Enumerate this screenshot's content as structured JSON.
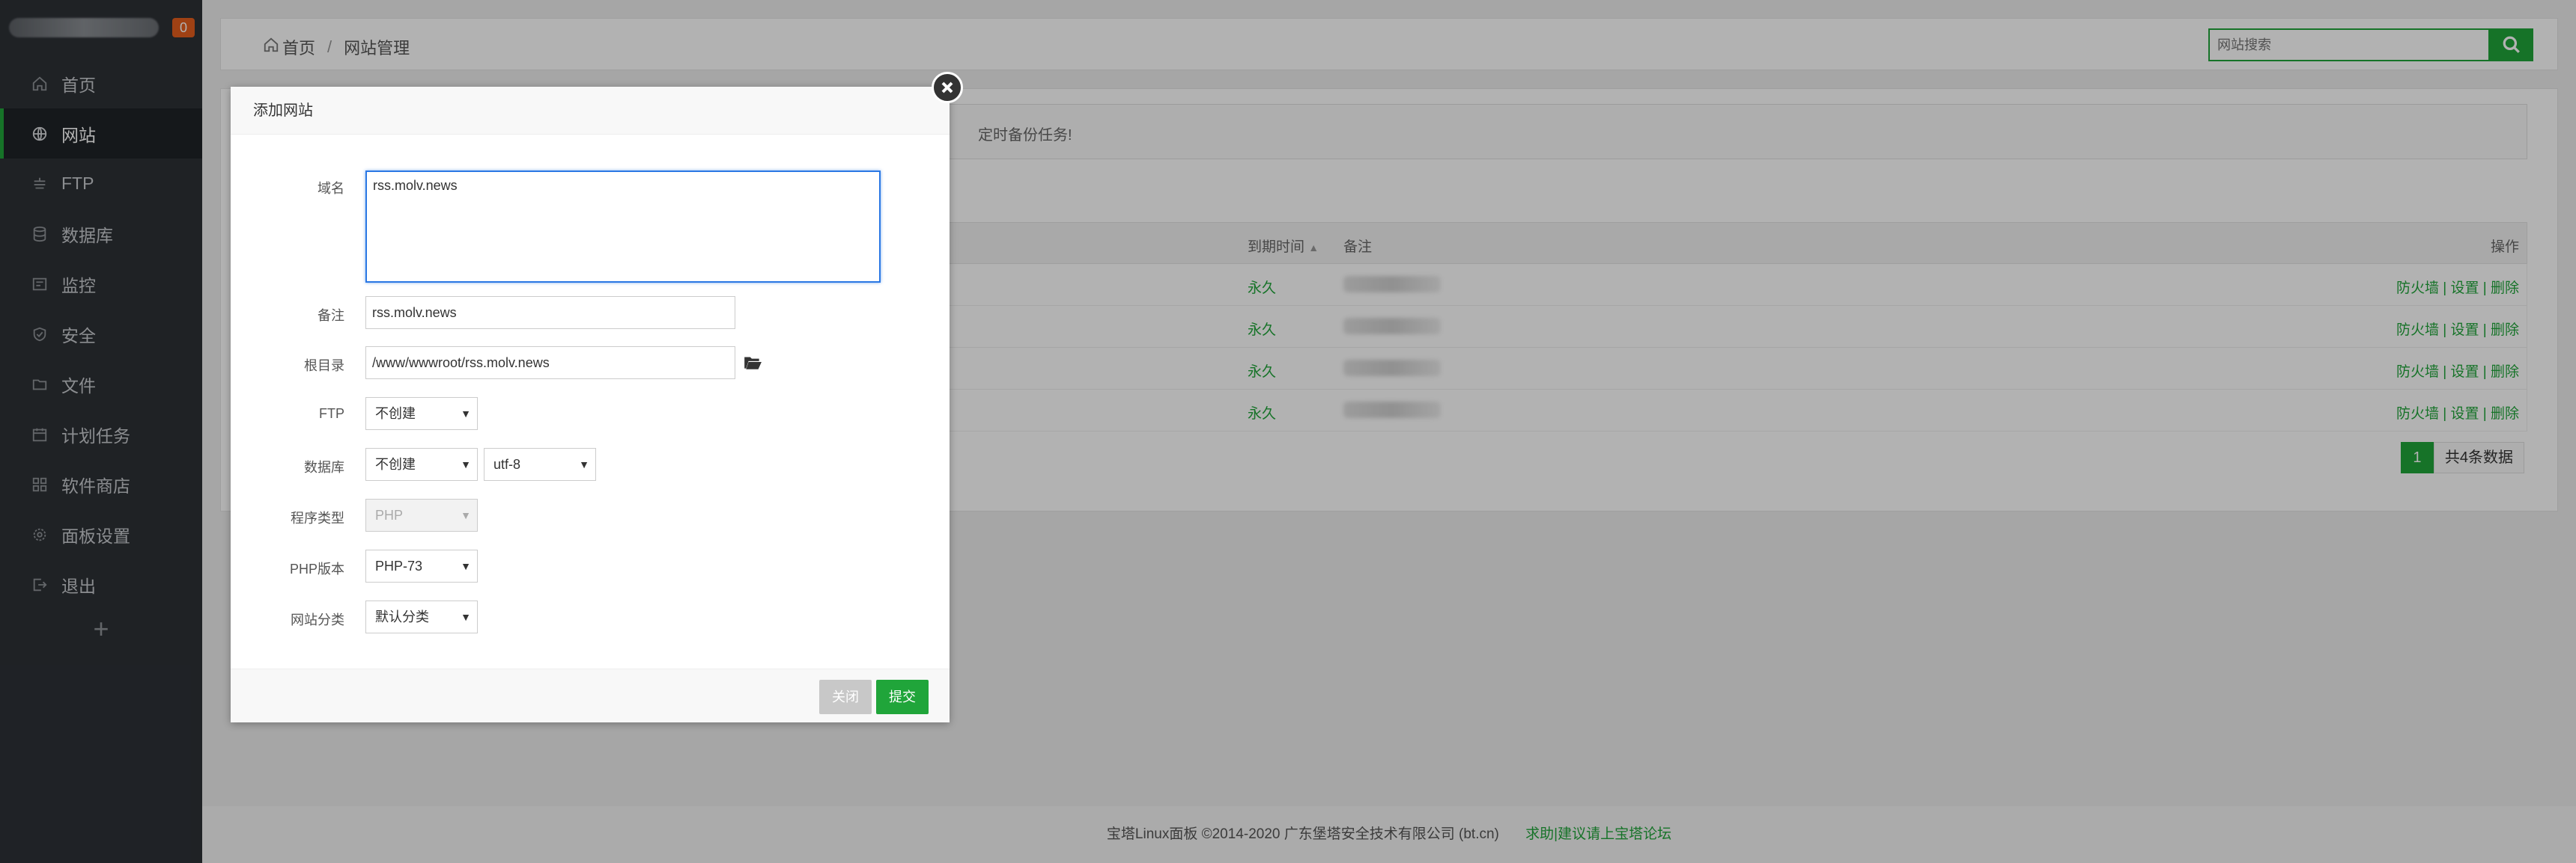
{
  "sidebar": {
    "badge": "0",
    "items": [
      {
        "label": "首页",
        "icon": "home-icon"
      },
      {
        "label": "网站",
        "icon": "globe-icon",
        "active": true
      },
      {
        "label": "FTP",
        "icon": "ftp-icon"
      },
      {
        "label": "数据库",
        "icon": "database-icon"
      },
      {
        "label": "监控",
        "icon": "monitor-icon"
      },
      {
        "label": "安全",
        "icon": "shield-icon"
      },
      {
        "label": "文件",
        "icon": "folder-icon"
      },
      {
        "label": "计划任务",
        "icon": "calendar-icon"
      },
      {
        "label": "软件商店",
        "icon": "grid-icon"
      },
      {
        "label": "面板设置",
        "icon": "gear-icon"
      },
      {
        "label": "退出",
        "icon": "logout-icon"
      }
    ],
    "add_label": "+"
  },
  "header": {
    "breadcrumb_home": "首页",
    "breadcrumb_sep": "/",
    "breadcrumb_current": "网站管理",
    "search_placeholder": "网站搜索"
  },
  "content": {
    "tip_text": "定时备份任务!",
    "columns": {
      "expire": "到期时间",
      "note": "备注",
      "ops": "操作"
    },
    "rows": [
      {
        "expire": "永久",
        "ops": "防火墙 | 设置 | 删除"
      },
      {
        "expire": "永久",
        "ops": "防火墙 | 设置 | 删除"
      },
      {
        "expire": "永久",
        "ops": "防火墙 | 设置 | 删除"
      },
      {
        "expire": "永久",
        "ops": "防火墙 | 设置 | 删除"
      }
    ],
    "pager_page": "1",
    "pager_total": "共4条数据"
  },
  "footer": {
    "copyright": "宝塔Linux面板 ©2014-2020 广东堡塔安全技术有限公司 (bt.cn)",
    "link": "求助|建议请上宝塔论坛"
  },
  "modal": {
    "title": "添加网站",
    "domain_label": "域名",
    "domain_value": "rss.molv.news",
    "note_label": "备注",
    "note_value": "rss.molv.news",
    "root_label": "根目录",
    "root_value": "/www/wwwroot/rss.molv.news",
    "ftp_label": "FTP",
    "ftp_value": "不创建",
    "db_label": "数据库",
    "db_value": "不创建",
    "db_charset": "utf-8",
    "type_label": "程序类型",
    "type_value": "PHP",
    "php_label": "PHP版本",
    "php_value": "PHP-73",
    "category_label": "网站分类",
    "category_value": "默认分类",
    "close_label": "关闭",
    "submit_label": "提交"
  },
  "colors": {
    "accent": "#20a53a",
    "sidebar_bg": "#2d3136",
    "badge": "#e45d1e"
  }
}
